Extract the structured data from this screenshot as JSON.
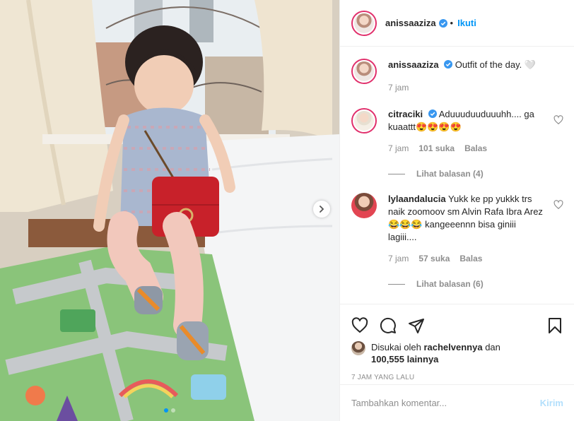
{
  "post": {
    "author": "anissaaziza",
    "follow_label": "Ikuti",
    "caption": "Outfit of the day. 🤍",
    "caption_time": "7 jam",
    "carousel_dots": 2,
    "carousel_active": 0
  },
  "comments": [
    {
      "user": "citraciki",
      "verified": true,
      "text": "Aduuuduuduuuhh.... ga kuaattt😍😍😍😍",
      "time": "7 jam",
      "likes": "101 suka",
      "reply_label": "Balas",
      "view_replies": "Lihat balasan (4)"
    },
    {
      "user": "lylaandalucia",
      "verified": false,
      "text": "Yukk ke pp yukkk trs naik zoomoov sm Alvin Rafa Ibra Arez 😂😂😂 kangeeennn bisa giniii lagiii....",
      "time": "7 jam",
      "likes": "57 suka",
      "reply_label": "Balas",
      "view_replies": "Lihat balasan (6)"
    }
  ],
  "likes": {
    "prefix": "Disukai oleh",
    "user": "rachelvennya",
    "joiner": "dan",
    "others": "100,555 lainnya"
  },
  "timestamp": "7 JAM YANG LALU",
  "add_comment": {
    "placeholder": "Tambahkan komentar...",
    "send_label": "Kirim"
  },
  "colors": {
    "accent": "#0095f6",
    "send_disabled": "#b2dffc",
    "muted": "#8e8e8e"
  }
}
